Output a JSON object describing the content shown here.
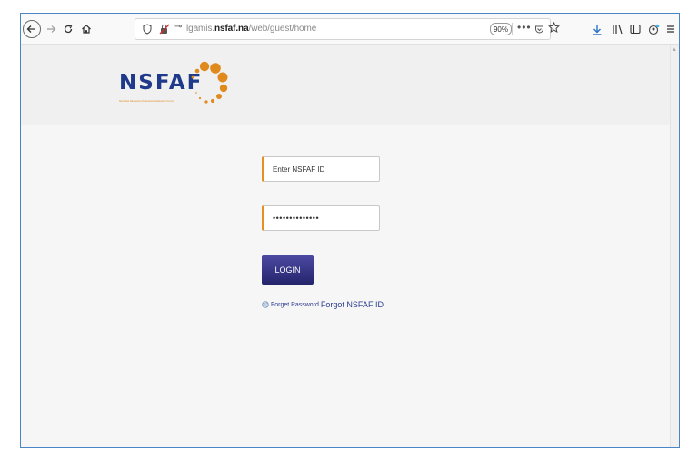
{
  "browser": {
    "url_prefix": "lgamis.",
    "url_domain": "nsfaf.na",
    "url_path": "/web/guest/home",
    "zoom": "90%",
    "more_label": "•••"
  },
  "logo": {
    "text": "NSFAF",
    "tagline": "Namibia Students Financial Assistance Fund",
    "dot_color": "#e08a1e",
    "text_color": "#1f3a8a"
  },
  "login": {
    "id_placeholder": "Enter NSFAF ID",
    "password_mask": "••••••••••••••",
    "button_label": "LOGIN",
    "forgot_password": "Forget Password",
    "forgot_id": "Forgot NSFAF ID",
    "accent_color": "#e8901f"
  },
  "icons": {
    "back": "back-arrow-icon",
    "forward": "forward-arrow-icon",
    "reload": "reload-icon",
    "home": "home-icon",
    "shield": "shield-icon",
    "lock": "insecure-lock-icon",
    "key": "key-icon",
    "pocket": "pocket-icon",
    "star": "star-icon",
    "download": "download-icon",
    "library": "library-icon",
    "sidebar": "sidebar-icon",
    "account": "account-icon",
    "menu": "hamburger-menu-icon",
    "forgot": "help-globe-icon"
  }
}
